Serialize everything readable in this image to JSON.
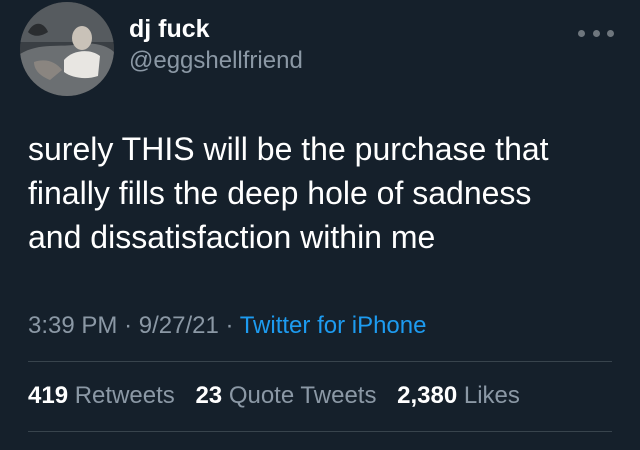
{
  "theme": {
    "background": "#15202b",
    "text_primary": "#ffffff",
    "text_secondary": "#8b98a5",
    "link": "#1d9bf0",
    "divider": "#38444d"
  },
  "author": {
    "display_name": "dj fuck",
    "handle": "@eggshellfriend",
    "avatar_icon": "user-photo-avatar"
  },
  "more_icon": "more-horizontal-icon",
  "tweet": {
    "text": "surely THIS will be the purchase that\nfinally fills the deep hole of sadness\nand dissatisfaction within me",
    "time": "3:39 PM",
    "separator": "·",
    "date": "9/27/21",
    "source": "Twitter for iPhone"
  },
  "stats": {
    "retweets_count": "419",
    "retweets_label": "Retweets",
    "quotes_count": "23",
    "quotes_label": "Quote Tweets",
    "likes_count": "2,380",
    "likes_label": "Likes"
  }
}
